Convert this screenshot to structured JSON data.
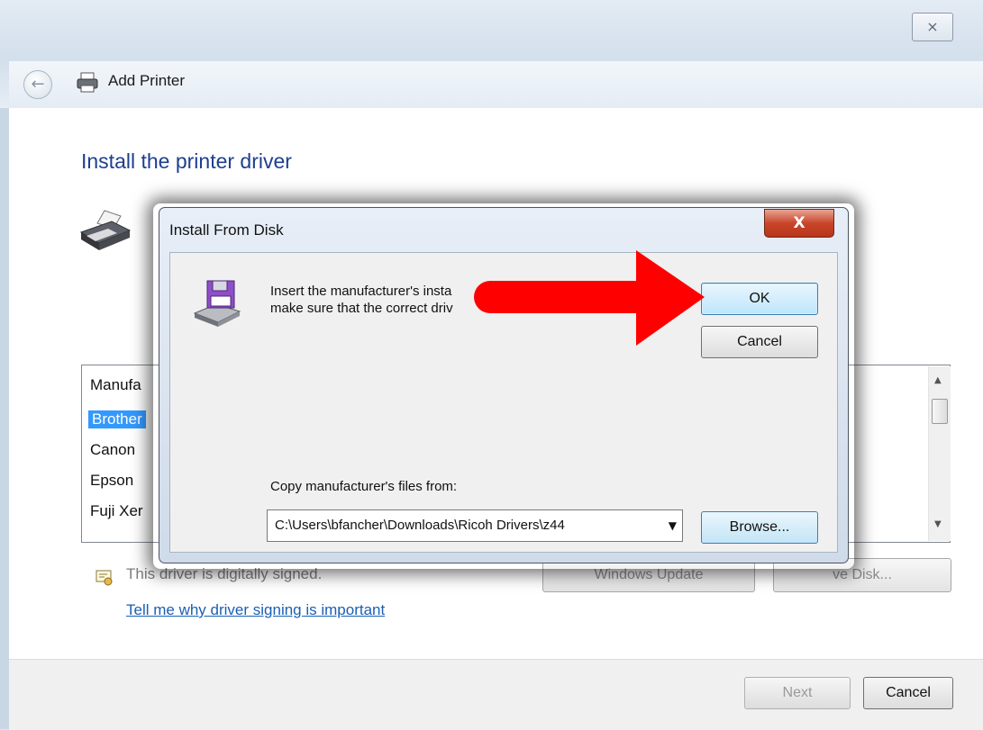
{
  "window": {
    "title": "Add Printer",
    "heading": "Install the printer driver",
    "close_glyph": "⨯",
    "back_glyph": "←"
  },
  "list": {
    "header": "Manufa",
    "items": [
      "Brother",
      "Canon",
      "Epson",
      "Fuji Xer"
    ],
    "selected_index": 0,
    "scroll_up": "▲",
    "scroll_down": "▼"
  },
  "signing": {
    "signed_text": "This driver is digitally signed.",
    "link_text": "Tell me why driver signing is important",
    "windows_update_label": "Windows Update",
    "have_disk_label": "ve Disk..."
  },
  "footer": {
    "next_label": "Next",
    "cancel_label": "Cancel"
  },
  "dialog": {
    "title": "Install From Disk",
    "close_glyph": "X",
    "message": "Insert the manufacturer's insta\nmake sure that the correct driv",
    "ok_label": "OK",
    "cancel_label": "Cancel",
    "copy_label": "Copy manufacturer's files from:",
    "path_value": "C:\\Users\\bfancher\\Downloads\\Ricoh Drivers\\z44",
    "browse_label": "Browse..."
  },
  "annotation": {
    "arrow_color": "#ff0000"
  }
}
